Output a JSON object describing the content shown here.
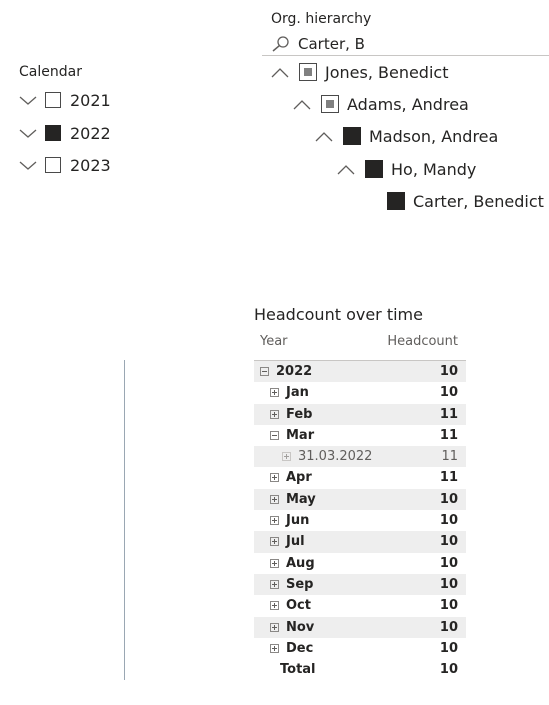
{
  "calendar": {
    "title": "Calendar",
    "items": [
      {
        "label": "2021",
        "state": "unchecked"
      },
      {
        "label": "2022",
        "state": "checked"
      },
      {
        "label": "2023",
        "state": "unchecked"
      }
    ]
  },
  "org": {
    "title": "Org. hierarchy",
    "search_value": "Carter, B",
    "items": [
      {
        "label": "Jones, Benedict",
        "state": "partial",
        "expander": true
      },
      {
        "label": "Adams, Andrea",
        "state": "partial",
        "expander": true
      },
      {
        "label": "Madson, Andrea",
        "state": "checked",
        "expander": true
      },
      {
        "label": "Ho, Mandy",
        "state": "checked",
        "expander": true
      },
      {
        "label": "Carter, Benedict",
        "state": "checked",
        "expander": false
      }
    ]
  },
  "matrix": {
    "title": "Headcount over time",
    "col_year": "Year",
    "col_headcount": "Headcount",
    "rows": [
      {
        "label": "2022",
        "value": "10",
        "level": 0,
        "toggle": "minus"
      },
      {
        "label": "Jan",
        "value": "10",
        "level": 1,
        "toggle": "plus"
      },
      {
        "label": "Feb",
        "value": "11",
        "level": 1,
        "toggle": "plus"
      },
      {
        "label": "Mar",
        "value": "11",
        "level": 1,
        "toggle": "minus"
      },
      {
        "label": "31.03.2022",
        "value": "11",
        "level": 2,
        "toggle": "plus"
      },
      {
        "label": "Apr",
        "value": "11",
        "level": 1,
        "toggle": "plus"
      },
      {
        "label": "May",
        "value": "10",
        "level": 1,
        "toggle": "plus"
      },
      {
        "label": "Jun",
        "value": "10",
        "level": 1,
        "toggle": "plus"
      },
      {
        "label": "Jul",
        "value": "10",
        "level": 1,
        "toggle": "plus"
      },
      {
        "label": "Aug",
        "value": "10",
        "level": 1,
        "toggle": "plus"
      },
      {
        "label": "Sep",
        "value": "10",
        "level": 1,
        "toggle": "plus"
      },
      {
        "label": "Oct",
        "value": "10",
        "level": 1,
        "toggle": "plus"
      },
      {
        "label": "Nov",
        "value": "10",
        "level": 1,
        "toggle": "plus"
      },
      {
        "label": "Dec",
        "value": "10",
        "level": 1,
        "toggle": "plus"
      }
    ],
    "total_label": "Total",
    "total_value": "10"
  },
  "icons": {
    "expand_down": "chevron-down-icon",
    "collapse_up": "chevron-up-icon",
    "search": "search-icon"
  }
}
